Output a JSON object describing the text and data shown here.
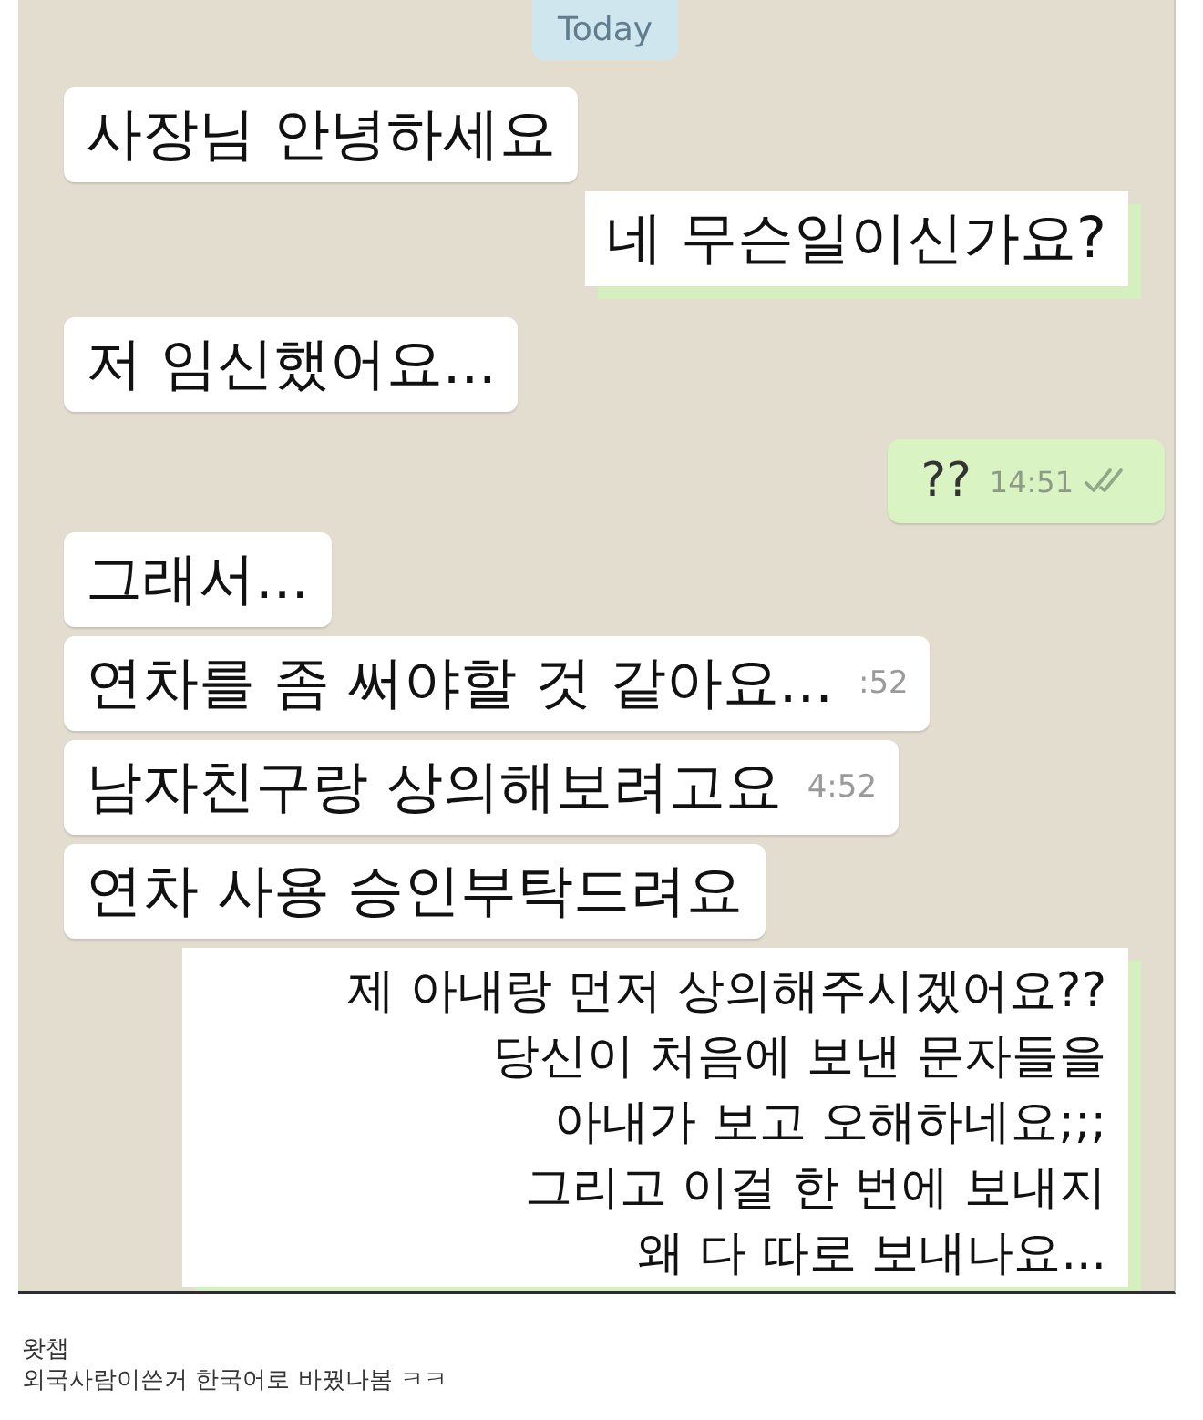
{
  "chat": {
    "date_chip": "Today",
    "messages": [
      {
        "kind": "received",
        "lines": [
          "사장님 안녕하세요"
        ],
        "read": false
      },
      {
        "kind": "overlay",
        "lines": [
          "네 무슨일이신가요?"
        ],
        "read": false
      },
      {
        "kind": "received",
        "lines": [
          "저 임신했어요..."
        ],
        "read": false
      },
      {
        "kind": "sent",
        "lines": [
          "??"
        ],
        "time": "14:51",
        "read": true
      },
      {
        "kind": "received",
        "lines": [
          "그래서..."
        ],
        "read": false
      },
      {
        "kind": "received",
        "lines": [
          "연차를 좀 써야할 것 같아요..."
        ],
        "time": ":52",
        "read": false
      },
      {
        "kind": "received",
        "lines": [
          "남자친구랑 상의해보려고요"
        ],
        "time": "4:52",
        "read": false
      },
      {
        "kind": "received",
        "lines": [
          "연차 사용 승인부탁드려요"
        ],
        "read": false
      },
      {
        "kind": "overlay",
        "lines": [
          "제 아내랑 먼저 상의해주시겠어요??",
          "당신이 처음에 보낸 문자들을",
          "아내가 보고 오해하네요;;;",
          "그리고 이걸 한 번에 보내지",
          "왜 다 따로 보내나요..."
        ],
        "read": false
      }
    ]
  },
  "caption": {
    "title": "왓챕",
    "text": "외국사람이쓴거 한국어로 바꿨나봄 ㅋㅋ"
  }
}
